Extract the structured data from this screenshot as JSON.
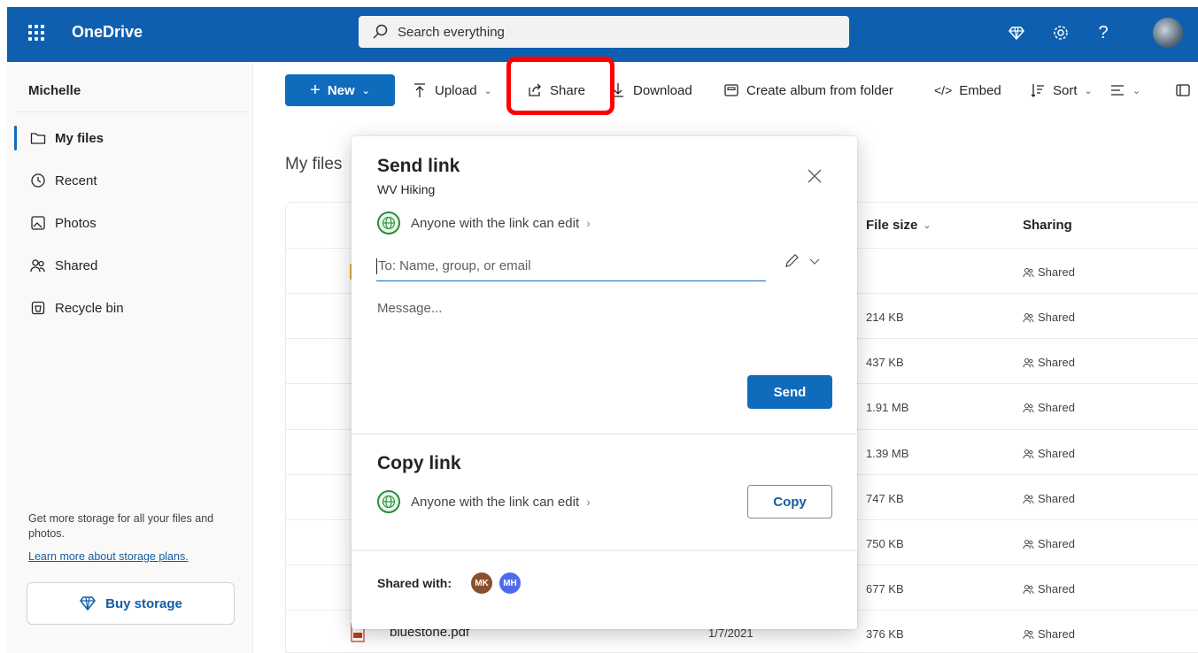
{
  "header": {
    "app_name": "OneDrive",
    "search_placeholder": "Search everything",
    "help_glyph": "?"
  },
  "sidebar": {
    "user_name": "Michelle",
    "items": [
      {
        "label": "My files",
        "icon": "folder-icon",
        "active": true
      },
      {
        "label": "Recent",
        "icon": "clock-icon",
        "active": false
      },
      {
        "label": "Photos",
        "icon": "image-icon",
        "active": false
      },
      {
        "label": "Shared",
        "icon": "people-icon",
        "active": false
      },
      {
        "label": "Recycle bin",
        "icon": "trash-icon",
        "active": false
      }
    ],
    "storage_text": "Get more storage for all your files and photos.",
    "storage_link": "Learn more about storage plans.",
    "buy_storage": "Buy storage"
  },
  "toolbar": {
    "new_label": "New",
    "upload_label": "Upload",
    "share_label": "Share",
    "download_label": "Download",
    "album_label": "Create album from folder",
    "embed_label": "Embed",
    "sort_label": "Sort"
  },
  "main": {
    "heading": "My files",
    "columns": {
      "file_size": "File size",
      "sharing": "Sharing"
    },
    "rows": [
      {
        "size": "",
        "sharing": "Shared"
      },
      {
        "size": "214 KB",
        "sharing": "Shared"
      },
      {
        "size": "437 KB",
        "sharing": "Shared"
      },
      {
        "size": "1.91 MB",
        "sharing": "Shared"
      },
      {
        "size": "1.39 MB",
        "sharing": "Shared"
      },
      {
        "size": "747 KB",
        "sharing": "Shared"
      },
      {
        "size": "750 KB",
        "sharing": "Shared"
      },
      {
        "size": "677 KB",
        "sharing": "Shared"
      },
      {
        "size": "376 KB",
        "sharing": "Shared",
        "name": "bluestone.pdf",
        "date": "1/7/2021"
      }
    ]
  },
  "dialog": {
    "title": "Send link",
    "item_name": "WV Hiking",
    "permission": "Anyone with the link can edit",
    "to_placeholder": "To: Name, group, or email",
    "message_placeholder": "Message...",
    "send_label": "Send",
    "copy_title": "Copy link",
    "copy_permission": "Anyone with the link can edit",
    "copy_label": "Copy",
    "shared_with_label": "Shared with:",
    "shared_with": [
      {
        "initials": "MK",
        "color": "#8a4f2b"
      },
      {
        "initials": "MH",
        "color": "#4f6bed"
      }
    ]
  },
  "colors": {
    "header_bg": "#0f5fb0",
    "accent": "#0f6cbd",
    "highlight": "#ff0000"
  }
}
